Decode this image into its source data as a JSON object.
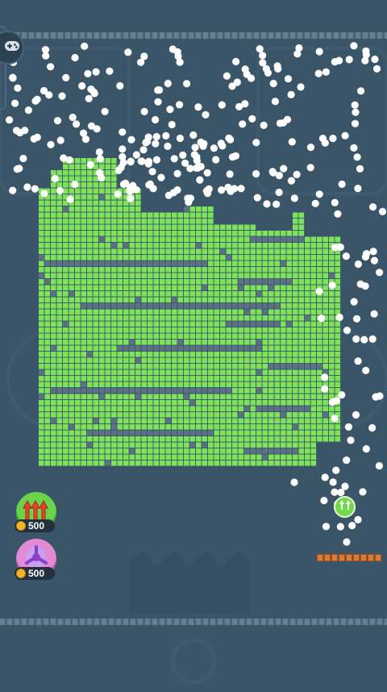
{
  "game": {
    "name": "brick-breaker",
    "colors": {
      "background": "#3a5468",
      "brick_filled": "#7ee25a",
      "brick_grid_line": "#56b83a",
      "brick_empty": "#5b7184",
      "ball": "#ffffff",
      "paddle": "#e07a33",
      "powerup_arrows": "#6bd24c",
      "powerup_split": "#e28ad6",
      "coin": "#f1b52b"
    },
    "icons": {
      "menu": "gamepad-icon",
      "powerup_arrows": "triple-up-arrow-icon",
      "powerup_split": "split-ball-icon",
      "coin": "coin-icon",
      "launcher": "ball-launcher-icon"
    }
  },
  "powerups": [
    {
      "name": "triple-arrow",
      "cost": "500"
    },
    {
      "name": "split-ball",
      "cost": "500"
    }
  ],
  "paddle": {
    "segments": 9
  }
}
